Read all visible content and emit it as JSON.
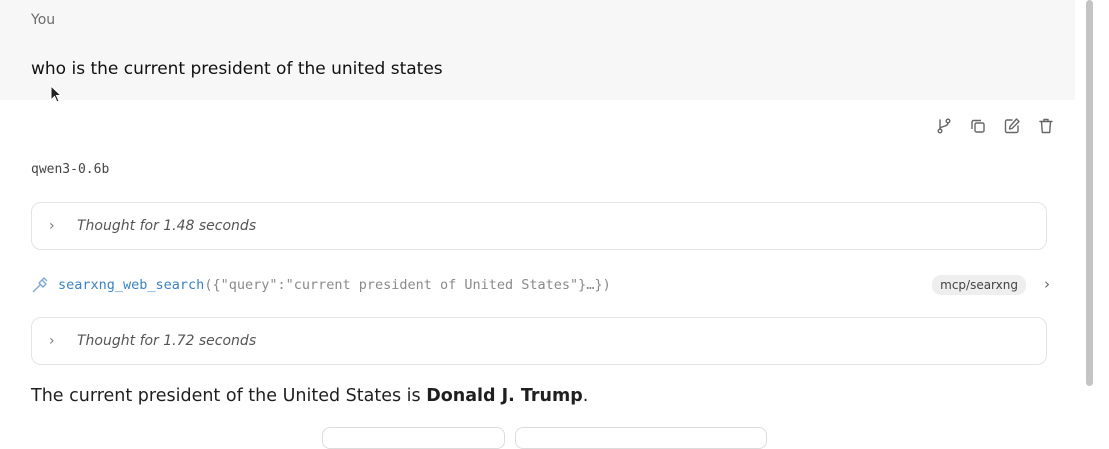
{
  "user_message": {
    "sender": "You",
    "text": "who is the current president of the united states"
  },
  "message_actions": {
    "icons": [
      "branch-icon",
      "copy-icon",
      "edit-icon",
      "delete-icon"
    ]
  },
  "assistant": {
    "model": "qwen3-0.6b",
    "thought_1": "Thought for 1.48 seconds",
    "tool_call": {
      "function": "searxng_web_search",
      "args": "({\"query\":\"current president of United States\"}…})",
      "badge": "mcp/searxng"
    },
    "thought_2": "Thought for 1.72 seconds",
    "answer_prefix": "The current president of the United States is ",
    "answer_bold": "Donald J. Trump",
    "answer_suffix": "."
  },
  "colors": {
    "tool_function": "#3b82c4",
    "user_bg": "#f7f7f7"
  }
}
